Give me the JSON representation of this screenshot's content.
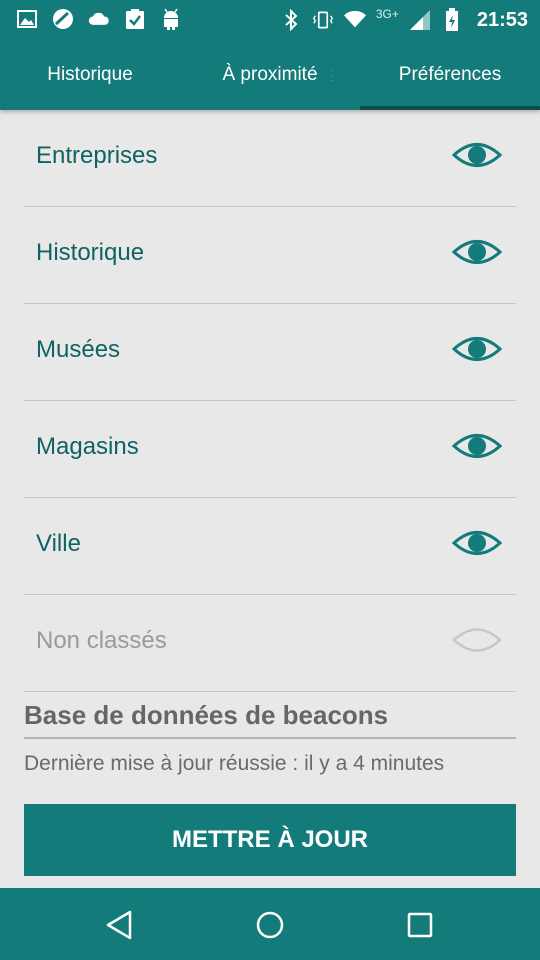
{
  "status_bar": {
    "time": "21:53",
    "network": "3G+",
    "left_icons": [
      "image-icon",
      "no-entry-icon",
      "cloud-icon",
      "clipboard-check-icon",
      "android-icon"
    ],
    "right_icons": [
      "bluetooth-icon",
      "vibrate-icon",
      "wifi-icon",
      "signal-icon",
      "battery-icon"
    ]
  },
  "tabs": [
    {
      "label": "Historique",
      "selected": false
    },
    {
      "label": "À proximité",
      "selected": false
    },
    {
      "label": "Préférences",
      "selected": true
    }
  ],
  "categories": [
    {
      "label": "Entreprises",
      "visible": true
    },
    {
      "label": "Historique",
      "visible": true
    },
    {
      "label": "Musées",
      "visible": true
    },
    {
      "label": "Magasins",
      "visible": true
    },
    {
      "label": "Ville",
      "visible": true
    },
    {
      "label": "Non classés",
      "visible": false
    }
  ],
  "beacons": {
    "title": "Base de données de beacons",
    "last_update": "Dernière mise à jour réussie : il y a 4 minutes",
    "update_button": "METTRE À JOUR"
  },
  "colors": {
    "primary": "#137b79",
    "eye_on": "#137b79",
    "eye_off": "#c7c7c7"
  },
  "nav_icons": [
    "back-icon",
    "home-icon",
    "recents-icon"
  ]
}
